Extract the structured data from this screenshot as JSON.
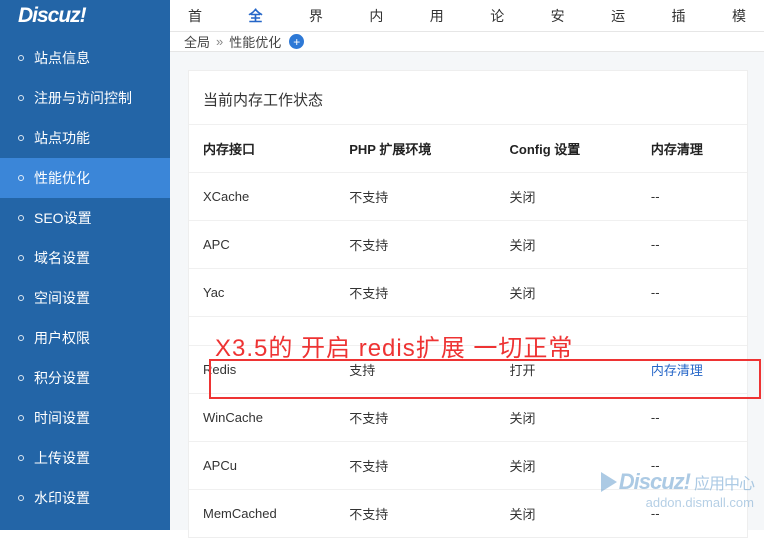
{
  "logo_text": "Discuz!",
  "top_tabs": [
    "首页",
    "全局",
    "界面",
    "内容",
    "用户",
    "论坛",
    "安全",
    "运营",
    "插件",
    "模"
  ],
  "top_active_index": 1,
  "breadcrumb": {
    "root": "全局",
    "sep": "»",
    "current": "性能优化"
  },
  "sidebar": {
    "items": [
      "站点信息",
      "注册与访问控制",
      "站点功能",
      "性能优化",
      "SEO设置",
      "域名设置",
      "空间设置",
      "用户权限",
      "积分设置",
      "时间设置",
      "上传设置",
      "水印设置"
    ],
    "active_index": 3
  },
  "panel": {
    "title": "当前内存工作状态",
    "columns": [
      "内存接口",
      "PHP 扩展环境",
      "Config 设置",
      "内存清理"
    ],
    "rows": [
      {
        "name": "XCache",
        "ext": "不支持",
        "config": "关闭",
        "clean": "--"
      },
      {
        "name": "APC",
        "ext": "不支持",
        "config": "关闭",
        "clean": "--"
      },
      {
        "name": "Yac",
        "ext": "不支持",
        "config": "关闭",
        "clean": "--"
      },
      {
        "name": "",
        "ext": "",
        "config": "",
        "clean": ""
      },
      {
        "name": "Redis",
        "ext": "支持",
        "config": "打开",
        "clean": "内存清理",
        "clean_link": true,
        "highlight": true
      },
      {
        "name": "WinCache",
        "ext": "不支持",
        "config": "关闭",
        "clean": "--"
      },
      {
        "name": "APCu",
        "ext": "不支持",
        "config": "关闭",
        "clean": "--"
      },
      {
        "name": "MemCached",
        "ext": "不支持",
        "config": "关闭",
        "clean": "--"
      }
    ]
  },
  "annotation_text": "X3.5的 开启 redis扩展 一切正常",
  "watermark": {
    "brand": "Discuz!",
    "cn": "应用中心",
    "url": "addon.dismall.com"
  }
}
